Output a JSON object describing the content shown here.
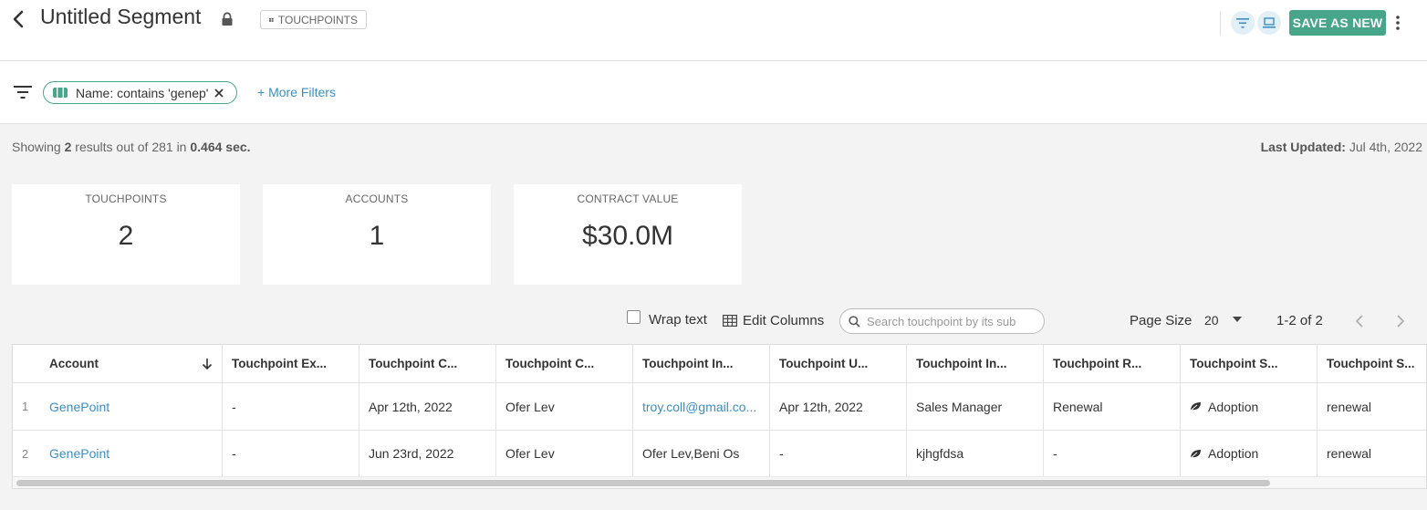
{
  "header": {
    "title": "Untitled Segment",
    "type_badge": "TOUCHPOINTS",
    "save_label": "SAVE AS NEW"
  },
  "filters": {
    "chip_label": "Name: contains 'genep'",
    "more_filters": "+ More Filters"
  },
  "summary": {
    "showing_prefix": "Showing",
    "shown_count": "2",
    "mid_text": "results out of 281 in",
    "elapsed": "0.464 sec.",
    "last_updated_label": "Last Updated:",
    "last_updated_value": "Jul 4th, 2022"
  },
  "cards": [
    {
      "label": "TOUCHPOINTS",
      "value": "2"
    },
    {
      "label": "ACCOUNTS",
      "value": "1"
    },
    {
      "label": "CONTRACT VALUE",
      "value": "$30.0M"
    }
  ],
  "toolbar": {
    "wrap_text": "Wrap text",
    "edit_columns": "Edit Columns",
    "search_placeholder": "Search touchpoint by its sub",
    "page_size_label": "Page Size",
    "page_size": "20",
    "range": "1-2 of 2"
  },
  "table": {
    "columns": [
      "Account",
      "Touchpoint Ex...",
      "Touchpoint C...",
      "Touchpoint C...",
      "Touchpoint In...",
      "Touchpoint U...",
      "Touchpoint In...",
      "Touchpoint R...",
      "Touchpoint S...",
      "Touchpoint S..."
    ],
    "rows": [
      {
        "num": "1",
        "cells": [
          "GenePoint",
          "-",
          "Apr 12th, 2022",
          "Ofer Lev",
          "troy.coll@gmail.co...",
          "Apr 12th, 2022",
          "Sales Manager",
          "Renewal",
          "Adoption",
          "renewal"
        ]
      },
      {
        "num": "2",
        "cells": [
          "GenePoint",
          "-",
          "Jun 23rd, 2022",
          "Ofer Lev",
          "Ofer Lev,Beni Os",
          "-",
          "kjhgfdsa",
          "-",
          "Adoption",
          "renewal"
        ]
      }
    ]
  },
  "colors": {
    "accent": "#47a68a",
    "link": "#3a8fc5"
  }
}
